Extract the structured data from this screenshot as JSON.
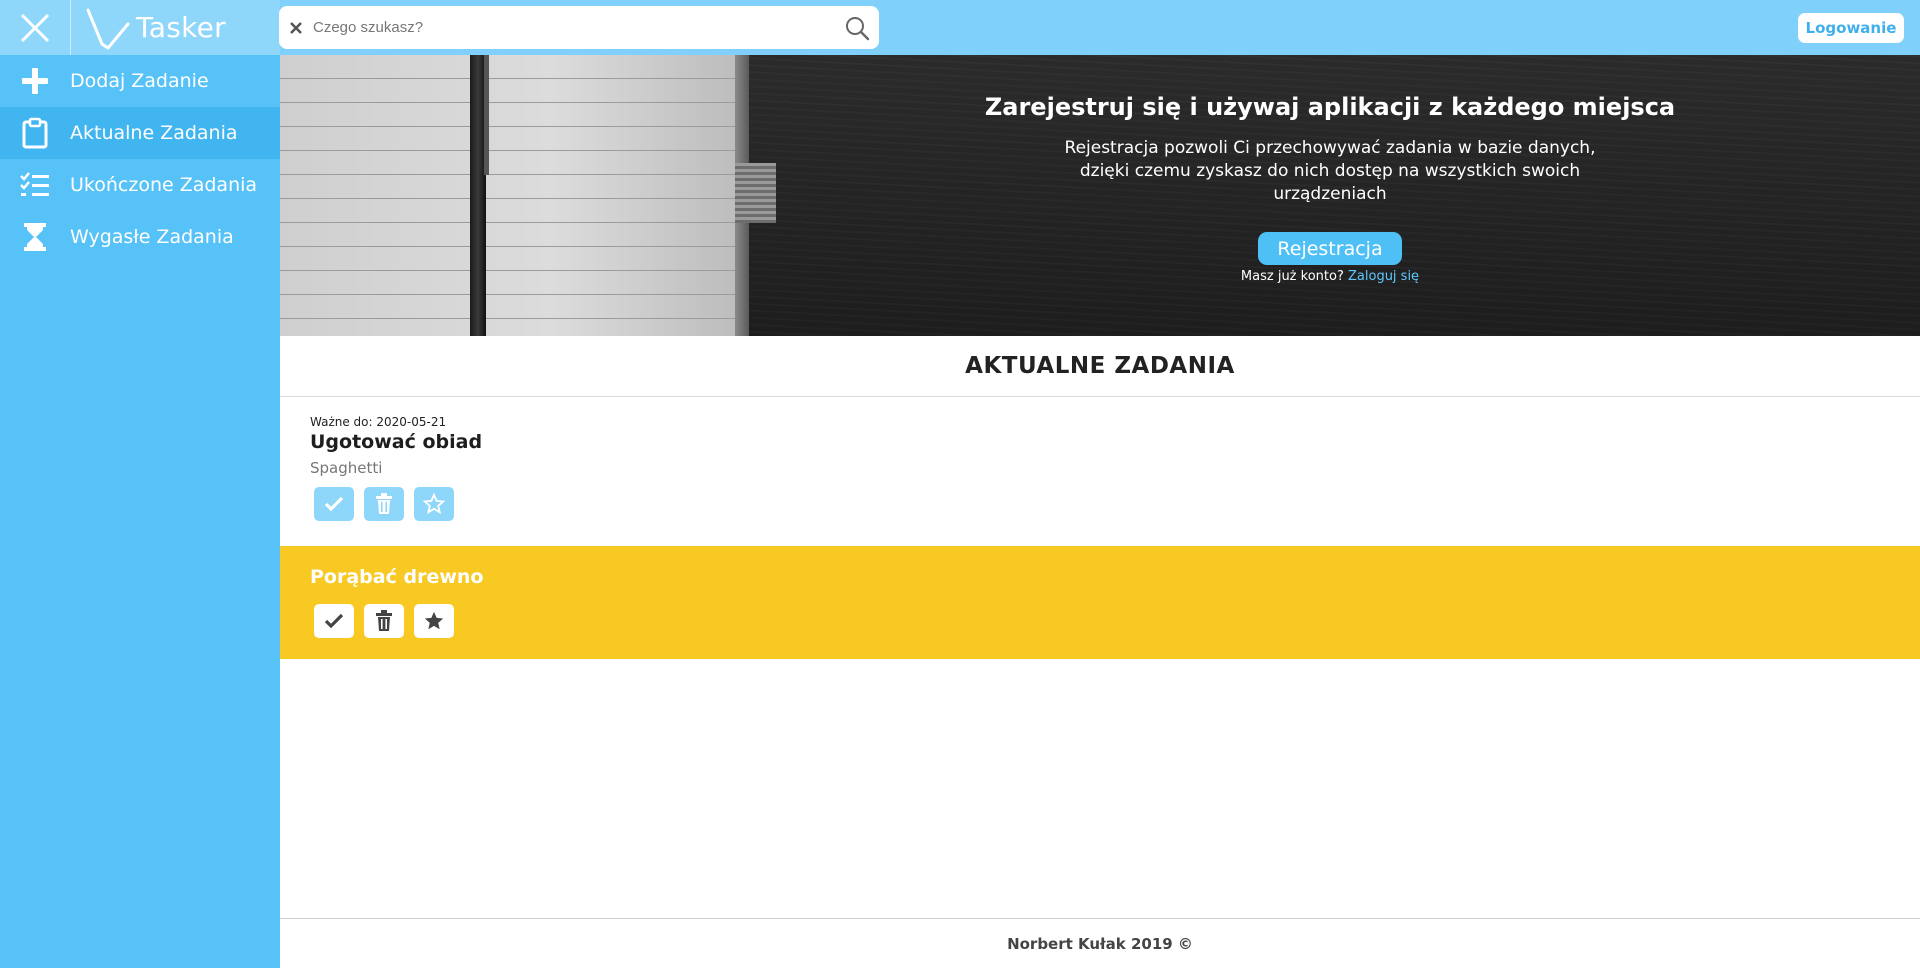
{
  "header": {
    "app_name": "Tasker",
    "search_placeholder": "Czego szukasz?",
    "login_label": "Logowanie"
  },
  "sidebar": {
    "items": [
      {
        "label": "Dodaj Zadanie",
        "icon": "plus-icon",
        "active": false
      },
      {
        "label": "Aktualne Zadania",
        "icon": "clipboard-icon",
        "active": true
      },
      {
        "label": "Ukończone Zadania",
        "icon": "checklist-icon",
        "active": false
      },
      {
        "label": "Wygasłe Zadania",
        "icon": "hourglass-icon",
        "active": false
      }
    ]
  },
  "hero": {
    "title": "Zarejestruj się i używaj aplikacji z każdego miejsca",
    "text": "Rejestracja pozwoli Ci przechowywać zadania w bazie danych, dzięki czemu zyskasz do nich dostęp na wszystkich swoich urządzeniach",
    "register_label": "Rejestracja",
    "have_account": "Masz już konto?",
    "login_link": "Zaloguj się"
  },
  "section": {
    "title": "AKTUALNE ZADANIA"
  },
  "tasks": [
    {
      "due": "Ważne do: 2020-05-21",
      "title": "Ugotować obiad",
      "description": "Spaghetti",
      "important": false
    },
    {
      "title": "Porąbać drewno",
      "important": true
    }
  ],
  "footer": {
    "text": "Norbert Kułak 2019 ©"
  },
  "colors": {
    "accent": "#56c2f7",
    "header": "#7fd0fb",
    "important_task": "#f8c823"
  }
}
